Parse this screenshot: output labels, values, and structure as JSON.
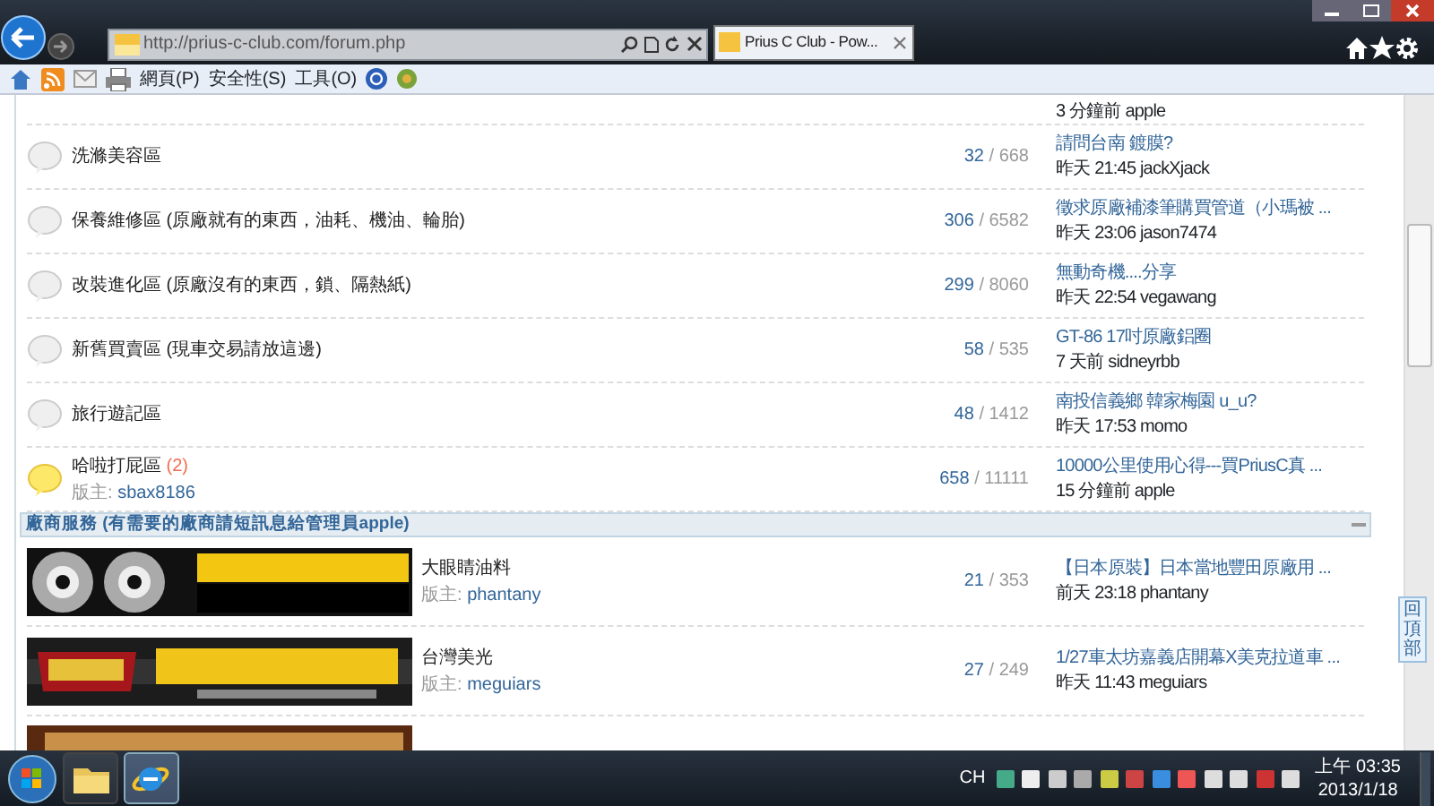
{
  "browser": {
    "address": "http://prius-c-club.com/forum.php",
    "tab_title": "Prius C Club - Pow...",
    "menus": [
      "網頁(P)",
      "安全性(S)",
      "工具(O)"
    ]
  },
  "count_separator": "/",
  "forums": [
    {
      "kind": "partial",
      "last_post": "3 分鐘前 apple"
    },
    {
      "kind": "forum",
      "title": "洗滌美容區",
      "new": false,
      "topics": "32",
      "posts": "668",
      "last_post_title": "請問台南 鍍膜?",
      "last_post": "昨天 21:45 jackXjack"
    },
    {
      "kind": "forum",
      "title": "保養維修區 (原廠就有的東西，油耗、機油、輪胎)",
      "new": false,
      "topics": "306",
      "posts": "6582",
      "last_post_title": "徵求原廠補漆筆購買管道（小瑪被 ...",
      "last_post": "昨天 23:06 jason7474"
    },
    {
      "kind": "forum",
      "title": "改裝進化區 (原廠沒有的東西，鎖、隔熱紙)",
      "new": false,
      "topics": "299",
      "posts": "8060",
      "last_post_title": "無動奇機....分享",
      "last_post": "昨天 22:54 vegawang"
    },
    {
      "kind": "forum",
      "title": "新舊買賣區 (現車交易請放這邊)",
      "new": false,
      "topics": "58",
      "posts": "535",
      "last_post_title": "GT-86 17吋原廠鋁圈",
      "last_post": "7 天前 sidneyrbb"
    },
    {
      "kind": "forum",
      "title": "旅行遊記區",
      "new": false,
      "topics": "48",
      "posts": "1412",
      "last_post_title": "南投信義鄉 韓家梅園 u_u?",
      "last_post": "昨天 17:53 momo"
    },
    {
      "kind": "forum",
      "title": "哈啦打屁區",
      "today_count": "(2)",
      "new": true,
      "moderator_label": "版主:",
      "moderator": "sbax8186",
      "topics": "658",
      "posts": "11111",
      "last_post_title": "10000公里使用心得---買PriusC真 ...",
      "last_post": "15 分鐘前 apple"
    }
  ],
  "vendor_section": {
    "title": "廠商服務 (有需要的廠商請短訊息給管理員apple)",
    "expanded": true,
    "rows": [
      {
        "kind": "forum",
        "name": "大眼睛油料",
        "moderator_label": "版主:",
        "moderator": "phantany",
        "topics": "21",
        "posts": "353",
        "last_post_title": "【日本原裝】日本當地豐田原廠用 ...",
        "last_post": "前天 23:18 phantany"
      },
      {
        "kind": "forum",
        "name": "台灣美光",
        "moderator_label": "版主:",
        "moderator": "meguiars",
        "topics": "27",
        "posts": "249",
        "last_post_title": "1/27車太坊嘉義店開幕X美克拉道車 ...",
        "last_post": "昨天 11:43 meguiars"
      },
      {
        "kind": "partial"
      }
    ]
  },
  "back_to_top": "回頂部",
  "taskbar": {
    "language": "CH",
    "time": "上午 03:35",
    "date": "2013/1/18"
  }
}
